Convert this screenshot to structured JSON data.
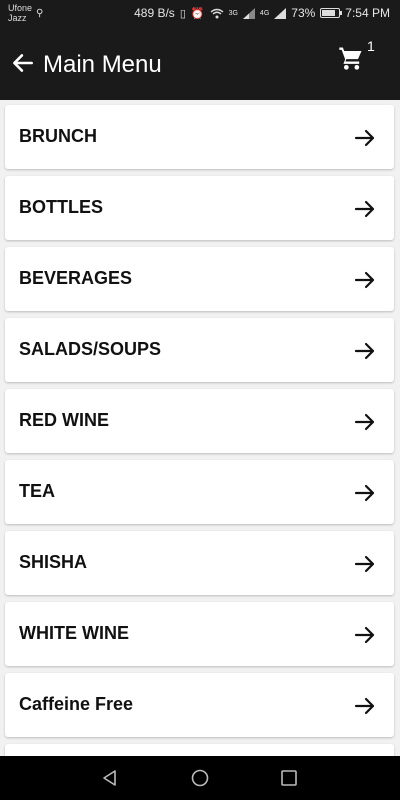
{
  "status_bar": {
    "carrier_line1": "Ufone",
    "carrier_line2": "Jazz",
    "data_speed": "489 B/s",
    "network_3g": "3G",
    "network_4g": "4G",
    "battery": "73%",
    "time": "7:54 PM"
  },
  "app_bar": {
    "title": "Main Menu",
    "cart_count": "1"
  },
  "menu": {
    "items": [
      {
        "label": "BRUNCH"
      },
      {
        "label": "BOTTLES"
      },
      {
        "label": "BEVERAGES"
      },
      {
        "label": "SALADS/SOUPS"
      },
      {
        "label": "RED WINE"
      },
      {
        "label": "TEA"
      },
      {
        "label": "SHISHA"
      },
      {
        "label": "WHITE WINE"
      },
      {
        "label": "Caffeine Free"
      }
    ]
  },
  "colors": {
    "app_bar_bg": "#1a1a1a",
    "list_bg": "#f1f1f1",
    "card_bg": "#ffffff"
  }
}
